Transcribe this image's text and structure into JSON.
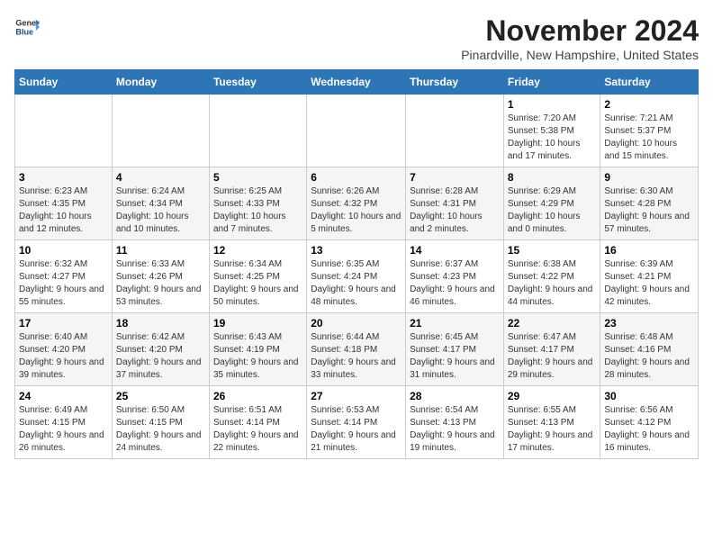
{
  "header": {
    "logo": {
      "line1": "General",
      "line2": "Blue"
    },
    "title": "November 2024",
    "subtitle": "Pinardville, New Hampshire, United States"
  },
  "days_of_week": [
    "Sunday",
    "Monday",
    "Tuesday",
    "Wednesday",
    "Thursday",
    "Friday",
    "Saturday"
  ],
  "weeks": [
    [
      {
        "day": "",
        "info": ""
      },
      {
        "day": "",
        "info": ""
      },
      {
        "day": "",
        "info": ""
      },
      {
        "day": "",
        "info": ""
      },
      {
        "day": "",
        "info": ""
      },
      {
        "day": "1",
        "info": "Sunrise: 7:20 AM\nSunset: 5:38 PM\nDaylight: 10 hours and 17 minutes."
      },
      {
        "day": "2",
        "info": "Sunrise: 7:21 AM\nSunset: 5:37 PM\nDaylight: 10 hours and 15 minutes."
      }
    ],
    [
      {
        "day": "3",
        "info": "Sunrise: 6:23 AM\nSunset: 4:35 PM\nDaylight: 10 hours and 12 minutes."
      },
      {
        "day": "4",
        "info": "Sunrise: 6:24 AM\nSunset: 4:34 PM\nDaylight: 10 hours and 10 minutes."
      },
      {
        "day": "5",
        "info": "Sunrise: 6:25 AM\nSunset: 4:33 PM\nDaylight: 10 hours and 7 minutes."
      },
      {
        "day": "6",
        "info": "Sunrise: 6:26 AM\nSunset: 4:32 PM\nDaylight: 10 hours and 5 minutes."
      },
      {
        "day": "7",
        "info": "Sunrise: 6:28 AM\nSunset: 4:31 PM\nDaylight: 10 hours and 2 minutes."
      },
      {
        "day": "8",
        "info": "Sunrise: 6:29 AM\nSunset: 4:29 PM\nDaylight: 10 hours and 0 minutes."
      },
      {
        "day": "9",
        "info": "Sunrise: 6:30 AM\nSunset: 4:28 PM\nDaylight: 9 hours and 57 minutes."
      }
    ],
    [
      {
        "day": "10",
        "info": "Sunrise: 6:32 AM\nSunset: 4:27 PM\nDaylight: 9 hours and 55 minutes."
      },
      {
        "day": "11",
        "info": "Sunrise: 6:33 AM\nSunset: 4:26 PM\nDaylight: 9 hours and 53 minutes."
      },
      {
        "day": "12",
        "info": "Sunrise: 6:34 AM\nSunset: 4:25 PM\nDaylight: 9 hours and 50 minutes."
      },
      {
        "day": "13",
        "info": "Sunrise: 6:35 AM\nSunset: 4:24 PM\nDaylight: 9 hours and 48 minutes."
      },
      {
        "day": "14",
        "info": "Sunrise: 6:37 AM\nSunset: 4:23 PM\nDaylight: 9 hours and 46 minutes."
      },
      {
        "day": "15",
        "info": "Sunrise: 6:38 AM\nSunset: 4:22 PM\nDaylight: 9 hours and 44 minutes."
      },
      {
        "day": "16",
        "info": "Sunrise: 6:39 AM\nSunset: 4:21 PM\nDaylight: 9 hours and 42 minutes."
      }
    ],
    [
      {
        "day": "17",
        "info": "Sunrise: 6:40 AM\nSunset: 4:20 PM\nDaylight: 9 hours and 39 minutes."
      },
      {
        "day": "18",
        "info": "Sunrise: 6:42 AM\nSunset: 4:20 PM\nDaylight: 9 hours and 37 minutes."
      },
      {
        "day": "19",
        "info": "Sunrise: 6:43 AM\nSunset: 4:19 PM\nDaylight: 9 hours and 35 minutes."
      },
      {
        "day": "20",
        "info": "Sunrise: 6:44 AM\nSunset: 4:18 PM\nDaylight: 9 hours and 33 minutes."
      },
      {
        "day": "21",
        "info": "Sunrise: 6:45 AM\nSunset: 4:17 PM\nDaylight: 9 hours and 31 minutes."
      },
      {
        "day": "22",
        "info": "Sunrise: 6:47 AM\nSunset: 4:17 PM\nDaylight: 9 hours and 29 minutes."
      },
      {
        "day": "23",
        "info": "Sunrise: 6:48 AM\nSunset: 4:16 PM\nDaylight: 9 hours and 28 minutes."
      }
    ],
    [
      {
        "day": "24",
        "info": "Sunrise: 6:49 AM\nSunset: 4:15 PM\nDaylight: 9 hours and 26 minutes."
      },
      {
        "day": "25",
        "info": "Sunrise: 6:50 AM\nSunset: 4:15 PM\nDaylight: 9 hours and 24 minutes."
      },
      {
        "day": "26",
        "info": "Sunrise: 6:51 AM\nSunset: 4:14 PM\nDaylight: 9 hours and 22 minutes."
      },
      {
        "day": "27",
        "info": "Sunrise: 6:53 AM\nSunset: 4:14 PM\nDaylight: 9 hours and 21 minutes."
      },
      {
        "day": "28",
        "info": "Sunrise: 6:54 AM\nSunset: 4:13 PM\nDaylight: 9 hours and 19 minutes."
      },
      {
        "day": "29",
        "info": "Sunrise: 6:55 AM\nSunset: 4:13 PM\nDaylight: 9 hours and 17 minutes."
      },
      {
        "day": "30",
        "info": "Sunrise: 6:56 AM\nSunset: 4:12 PM\nDaylight: 9 hours and 16 minutes."
      }
    ]
  ]
}
